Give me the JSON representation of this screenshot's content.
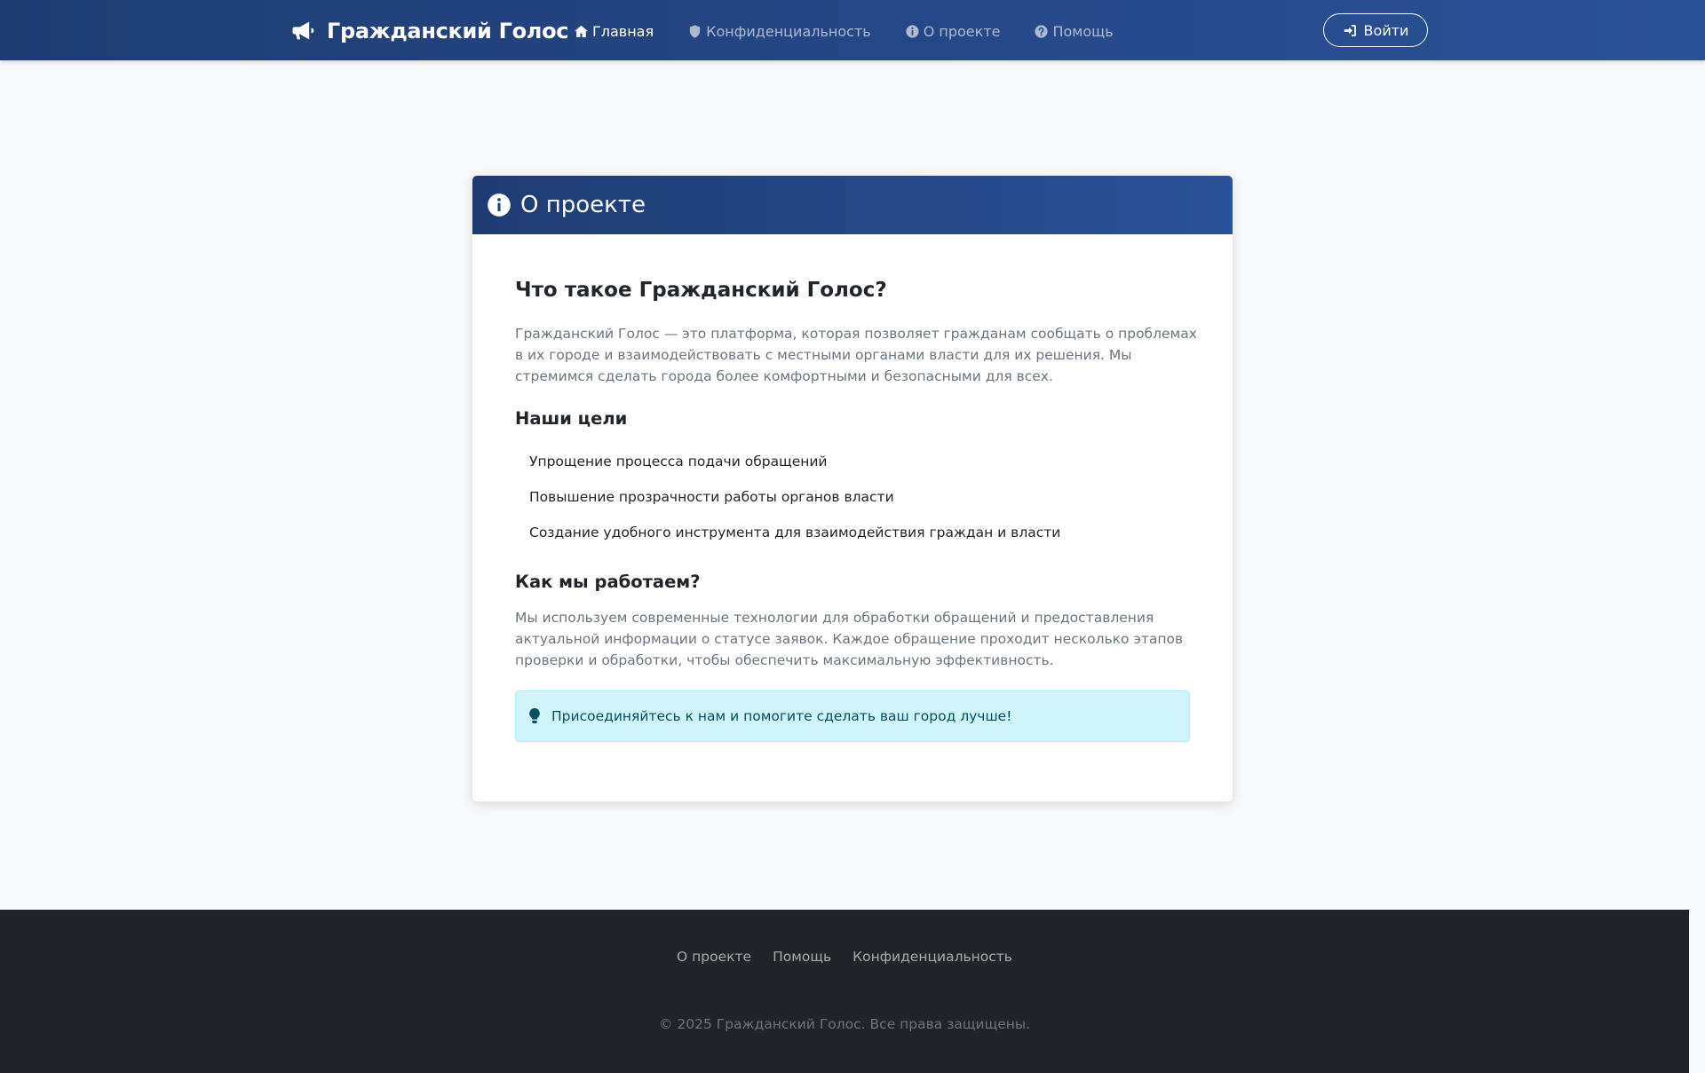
{
  "navbar": {
    "brand": "Гражданский Голос",
    "brand_icon": "megaphone-icon",
    "links": [
      {
        "label": "Главная",
        "icon": "home-icon",
        "active": true
      },
      {
        "label": "Конфиденциальность",
        "icon": "shield-icon",
        "active": false
      },
      {
        "label": "О проекте",
        "icon": "info-icon",
        "active": false
      },
      {
        "label": "Помощь",
        "icon": "question-icon",
        "active": false
      }
    ],
    "login_label": "Войти",
    "login_icon": "sign-in-icon"
  },
  "card": {
    "header_title": "О проекте",
    "heading": "Что такое Гражданский Голос?",
    "intro": "Гражданский Голос — это платформа, которая позволяет гражданам сообщать о проблемах в их городе и взаимодействовать с местными органами власти для их решения. Мы стремимся сделать города более комфортными и безопасными для всех.",
    "goals_heading": "Наши цели",
    "goals": [
      "Упрощение процесса подачи обращений",
      "Повышение прозрачности работы органов власти",
      "Создание удобного инструмента для взаимодействия граждан и власти"
    ],
    "how_heading": "Как мы работаем?",
    "how_text": "Мы используем современные технологии для обработки обращений и предоставления актуальной информации о статусе заявок. Каждое обращение проходит несколько этапов проверки и обработки, чтобы обеспечить максимальную эффективность.",
    "alert_text": "Присоединяйтесь к нам и помогите сделать ваш город лучше!",
    "alert_icon": "lightbulb-icon"
  },
  "footer": {
    "links": [
      "О проекте",
      "Помощь",
      "Конфиденциальность"
    ],
    "copyright": "© 2025 Гражданский Голос. Все права защищены."
  },
  "colors": {
    "header_gradient_start": "#1e3c72",
    "header_gradient_end": "#2a5298",
    "footer_bg": "#212529",
    "alert_bg": "#cff4fc",
    "alert_text": "#055160"
  }
}
